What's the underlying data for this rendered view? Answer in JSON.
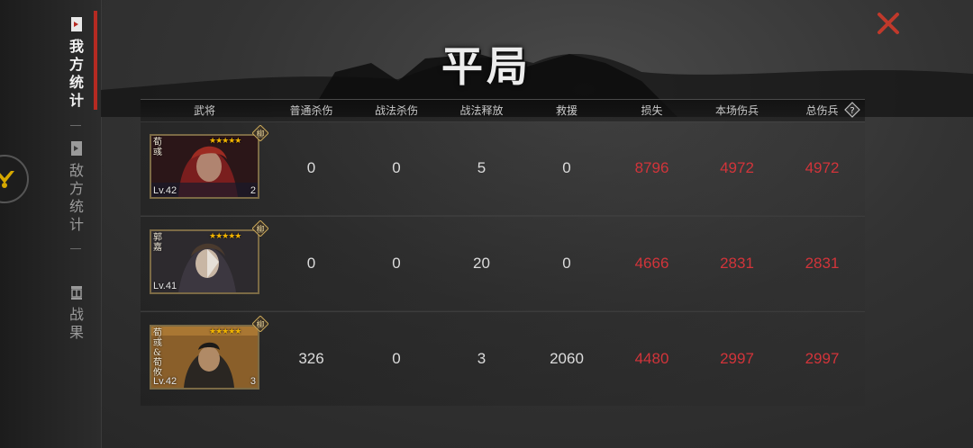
{
  "title": "平局",
  "sidebar": {
    "items": [
      {
        "label": [
          "我",
          "方",
          "统",
          "计"
        ],
        "icon": "our-stats-icon",
        "active": true
      },
      {
        "label": [
          "敌",
          "方",
          "统",
          "计"
        ],
        "icon": "enemy-stats-icon",
        "active": false
      },
      {
        "label": [
          "战",
          "果"
        ],
        "icon": "battle-result-icon",
        "active": false
      }
    ]
  },
  "table": {
    "headers": [
      "武将",
      "普通杀伤",
      "战法杀伤",
      "战法释放",
      "救援",
      "损失",
      "本场伤兵",
      "总伤兵"
    ],
    "rows": [
      {
        "general": {
          "name": "荀彧",
          "level": "Lv.42",
          "rank": "2",
          "stars": "★★★★★",
          "emblem": "柳"
        },
        "values": [
          "0",
          "0",
          "5",
          "0",
          "8796",
          "4972",
          "4972"
        ]
      },
      {
        "general": {
          "name": "郭嘉",
          "level": "Lv.41",
          "rank": "",
          "stars": "★★★★★",
          "emblem": "柳"
        },
        "values": [
          "0",
          "0",
          "20",
          "0",
          "4666",
          "2831",
          "2831"
        ]
      },
      {
        "general": {
          "name": "荀彧&荀攸",
          "level": "Lv.42",
          "rank": "3",
          "stars": "★★★★★",
          "emblem": "柳"
        },
        "values": [
          "326",
          "0",
          "3",
          "2060",
          "4480",
          "2997",
          "2997"
        ]
      }
    ]
  },
  "colors": {
    "loss_red": "#d2343a",
    "accent_red": "#b52a22",
    "star_gold": "#f2b400"
  },
  "icons": {
    "close": "close-icon",
    "help": "help-icon"
  }
}
